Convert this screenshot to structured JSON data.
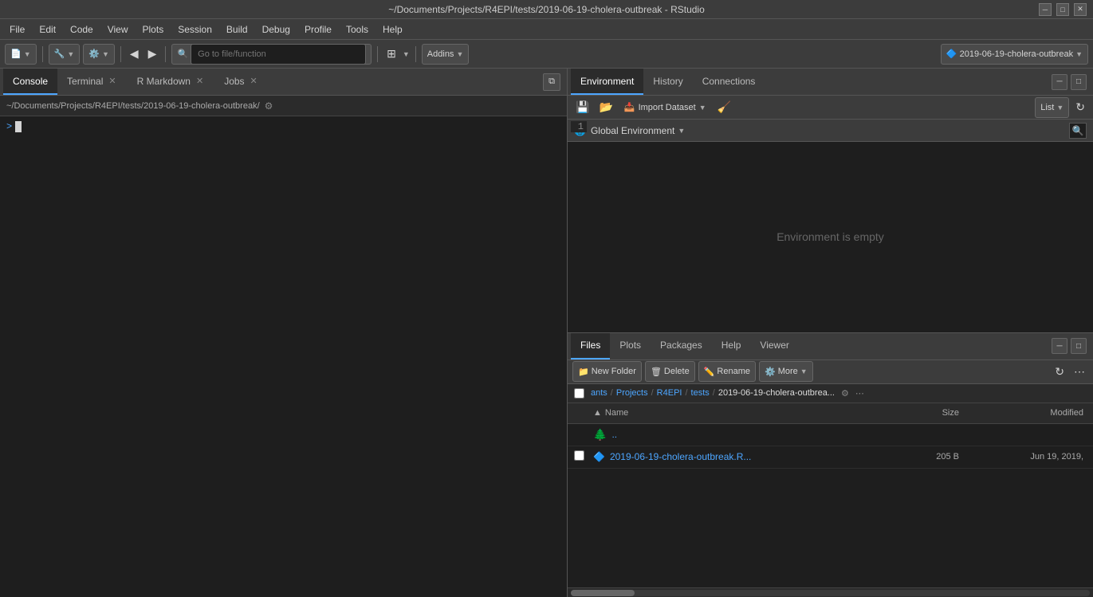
{
  "titlebar": {
    "title": "~/Documents/Projects/R4EPI/tests/2019-06-19-cholera-outbreak - RStudio"
  },
  "menubar": {
    "items": [
      "File",
      "Edit",
      "Code",
      "View",
      "Plots",
      "Session",
      "Build",
      "Debug",
      "Profile",
      "Tools",
      "Help"
    ]
  },
  "toolbar": {
    "search_placeholder": "Go to file/function",
    "addins_label": "Addins",
    "project_label": "2019-06-19-cholera-outbreak"
  },
  "left_panel": {
    "tabs": [
      {
        "label": "Console",
        "closable": false
      },
      {
        "label": "Terminal",
        "closable": true
      },
      {
        "label": "R Markdown",
        "closable": true
      },
      {
        "label": "Jobs",
        "closable": true
      }
    ],
    "active_tab": "Console",
    "breadcrumb": "~/Documents/Projects/R4EPI/tests/2019-06-19-cholera-outbreak/",
    "console_prompt": ">",
    "line_number": "1"
  },
  "right_top": {
    "tabs": [
      "Environment",
      "History",
      "Connections"
    ],
    "active_tab": "Environment",
    "import_label": "Import Dataset",
    "list_label": "List",
    "global_env_label": "Global Environment",
    "empty_message": "Environment is empty"
  },
  "right_bottom": {
    "tabs": [
      "Files",
      "Plots",
      "Packages",
      "Help",
      "Viewer"
    ],
    "active_tab": "Files",
    "toolbar": {
      "new_folder": "New Folder",
      "delete": "Delete",
      "rename": "Rename",
      "more": "More"
    },
    "breadcrumb": {
      "items": [
        "ants",
        "Projects",
        "R4EPI",
        "tests",
        "2019-06-19-cholera-outbrea..."
      ],
      "current": ""
    },
    "files_header": {
      "name_label": "Name",
      "size_label": "Size",
      "modified_label": "Modified"
    },
    "files": [
      {
        "name": "..",
        "size": "",
        "modified": "",
        "type": "parent"
      },
      {
        "name": "2019-06-19-cholera-outbreak.R...",
        "size": "205 B",
        "modified": "Jun 19, 2019,",
        "type": "r-file"
      }
    ]
  }
}
